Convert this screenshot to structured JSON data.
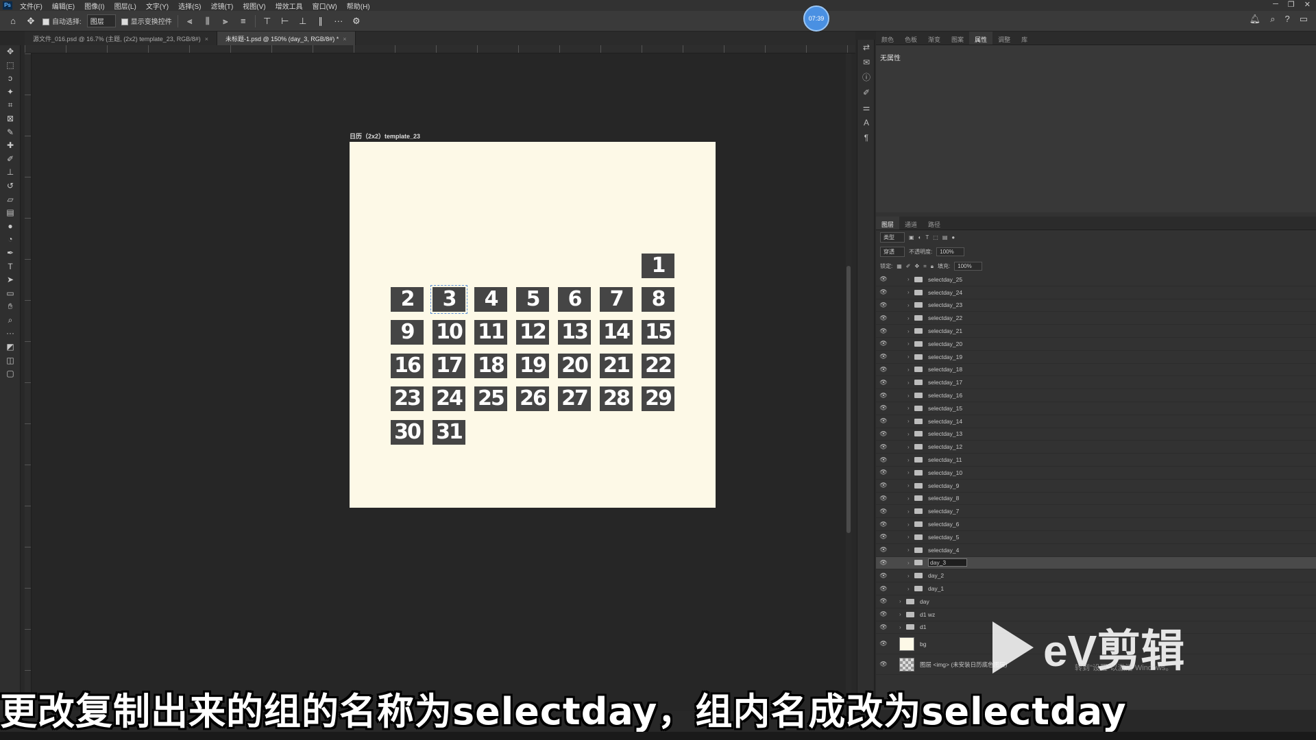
{
  "menubar": {
    "app_logo": "Ps",
    "items": [
      "文件(F)",
      "编辑(E)",
      "图像(I)",
      "图层(L)",
      "文字(Y)",
      "选择(S)",
      "滤镜(T)",
      "视图(V)",
      "增效工具",
      "窗口(W)",
      "帮助(H)"
    ]
  },
  "options": {
    "auto_select_label": "自动选择:",
    "auto_select_value": "图层",
    "show_transform_label": "显示变换控件",
    "more": "···"
  },
  "clock": "07:39",
  "tabs": [
    {
      "label": "源文件_016.psd @ 16.7% (主题, (2x2) template_23, RGB/8#)",
      "active": false
    },
    {
      "label": "未标题-1.psd @ 150% (day_3, RGB/8#) *",
      "active": true
    }
  ],
  "document": {
    "title": "日历（2x2）template_23",
    "days": [
      "1",
      "2",
      "3",
      "4",
      "5",
      "6",
      "7",
      "8",
      "9",
      "10",
      "11",
      "12",
      "13",
      "14",
      "15",
      "16",
      "17",
      "18",
      "19",
      "20",
      "21",
      "22",
      "23",
      "24",
      "25",
      "26",
      "27",
      "28",
      "29",
      "30",
      "31"
    ],
    "selected_day": "3"
  },
  "right_panel": {
    "top_tabs": [
      "颜色",
      "色板",
      "渐变",
      "图案",
      "属性",
      "调整",
      "库"
    ],
    "active_top_tab": "属性",
    "properties_text": "无属性",
    "layer_tabs": [
      "图层",
      "通道",
      "路径"
    ],
    "active_layer_tab": "图层",
    "kind_filter": "类型",
    "blend_mode": "穿透",
    "opacity_label": "不透明度:",
    "opacity_value": "100%",
    "lock_label": "锁定:",
    "fill_label": "填充:",
    "fill_value": "100%",
    "layers": [
      {
        "name": "selectday_25",
        "indent": 2,
        "type": "folder"
      },
      {
        "name": "selectday_24",
        "indent": 2,
        "type": "folder"
      },
      {
        "name": "selectday_23",
        "indent": 2,
        "type": "folder"
      },
      {
        "name": "selectday_22",
        "indent": 2,
        "type": "folder"
      },
      {
        "name": "selectday_21",
        "indent": 2,
        "type": "folder"
      },
      {
        "name": "selectday_20",
        "indent": 2,
        "type": "folder"
      },
      {
        "name": "selectday_19",
        "indent": 2,
        "type": "folder"
      },
      {
        "name": "selectday_18",
        "indent": 2,
        "type": "folder"
      },
      {
        "name": "selectday_17",
        "indent": 2,
        "type": "folder"
      },
      {
        "name": "selectday_16",
        "indent": 2,
        "type": "folder"
      },
      {
        "name": "selectday_15",
        "indent": 2,
        "type": "folder"
      },
      {
        "name": "selectday_14",
        "indent": 2,
        "type": "folder"
      },
      {
        "name": "selectday_13",
        "indent": 2,
        "type": "folder"
      },
      {
        "name": "selectday_12",
        "indent": 2,
        "type": "folder"
      },
      {
        "name": "selectday_11",
        "indent": 2,
        "type": "folder"
      },
      {
        "name": "selectday_10",
        "indent": 2,
        "type": "folder"
      },
      {
        "name": "selectday_9",
        "indent": 2,
        "type": "folder"
      },
      {
        "name": "selectday_8",
        "indent": 2,
        "type": "folder"
      },
      {
        "name": "selectday_7",
        "indent": 2,
        "type": "folder"
      },
      {
        "name": "selectday_6",
        "indent": 2,
        "type": "folder"
      },
      {
        "name": "selectday_5",
        "indent": 2,
        "type": "folder"
      },
      {
        "name": "selectday_4",
        "indent": 2,
        "type": "folder"
      },
      {
        "name": "day_3",
        "indent": 2,
        "type": "folder",
        "selected": true,
        "editing": true
      },
      {
        "name": "day_2",
        "indent": 2,
        "type": "folder"
      },
      {
        "name": "day_1",
        "indent": 2,
        "type": "folder"
      },
      {
        "name": "day",
        "indent": 1,
        "type": "folder"
      },
      {
        "name": "d1 wz",
        "indent": 1,
        "type": "folder"
      },
      {
        "name": "d1",
        "indent": 1,
        "type": "folder"
      },
      {
        "name": "bg",
        "indent": 1,
        "type": "thumb"
      },
      {
        "name": "图层 <img> (未安装日历底色图层)",
        "indent": 1,
        "type": "checker"
      }
    ]
  },
  "subtitle": "更改复制出来的组的名称为selectday，组内名成改为selectday",
  "watermark": "eV剪辑",
  "activation": "转到\"设置\"以激活 Windows。",
  "icons": {
    "tools": [
      "move-icon",
      "marquee-icon",
      "lasso-icon",
      "magic-wand-icon",
      "crop-icon",
      "frame-icon",
      "eyedropper-icon",
      "healing-icon",
      "brush-icon",
      "stamp-icon",
      "history-brush-icon",
      "eraser-icon",
      "gradient-icon",
      "blur-icon",
      "dodge-icon",
      "pen-icon",
      "type-icon",
      "path-select-icon",
      "rectangle-icon",
      "hand-icon",
      "zoom-icon",
      "more-tools-icon"
    ]
  }
}
